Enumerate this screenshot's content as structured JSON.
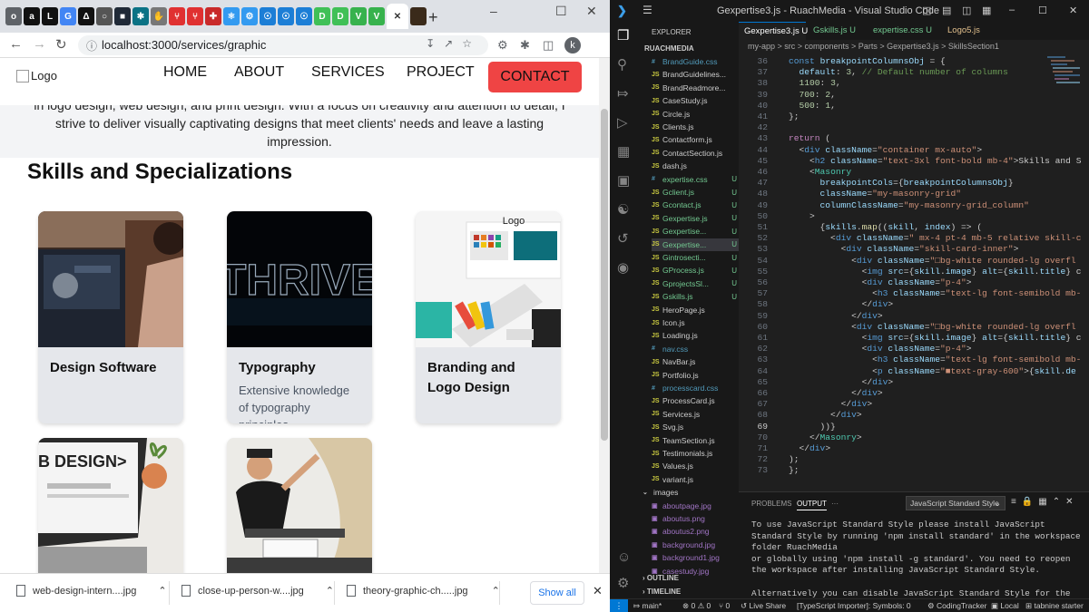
{
  "chrome": {
    "url": "localhost:3000/services/graphic",
    "window_controls": [
      "–",
      "☐",
      "✕"
    ],
    "tabs": [
      {
        "icon": "o",
        "color": "#5f6368"
      },
      {
        "icon": "a",
        "color": "#111"
      },
      {
        "icon": "L",
        "color": "#111"
      },
      {
        "icon": "G",
        "color": "#4285f4"
      },
      {
        "icon": "Δ",
        "color": "#111"
      },
      {
        "icon": "○",
        "color": "#555"
      },
      {
        "icon": "■",
        "color": "#1f2937"
      },
      {
        "icon": "✱",
        "color": "#0b7285"
      },
      {
        "icon": "✋",
        "color": "#777"
      },
      {
        "icon": "⑂",
        "color": "#e03131"
      },
      {
        "icon": "⑂",
        "color": "#e03131"
      },
      {
        "icon": "✚",
        "color": "#c92a2a"
      },
      {
        "icon": "⚛",
        "color": "#339af0"
      },
      {
        "icon": "⚙",
        "color": "#339af0"
      },
      {
        "icon": "☉",
        "color": "#1c7ed6"
      },
      {
        "icon": "☉",
        "color": "#1c7ed6"
      },
      {
        "icon": "☉",
        "color": "#1c7ed6"
      },
      {
        "icon": "D",
        "color": "#40c057"
      },
      {
        "icon": "D",
        "color": "#40c057"
      },
      {
        "icon": "V",
        "color": "#37b24d"
      },
      {
        "icon": "V",
        "color": "#37b24d"
      }
    ],
    "active_tab_close": "✕",
    "new_tab": "+",
    "avatar": "k"
  },
  "site": {
    "logo_alt": "Logo",
    "nav": [
      "HOME",
      "ABOUT",
      "SERVICES",
      "PROJECT"
    ],
    "contact": "CONTACT",
    "intro": "in logo design, web design, and print design. With a focus on creativity and attention to detail, I strive to deliver visually captivating designs that meet clients' needs and leave a lasting impression.",
    "section_title": "Skills and Specializations",
    "cards": [
      {
        "title": "Design Software",
        "desc": ""
      },
      {
        "title": "Typography",
        "desc": "Extensive knowledge of typography principles",
        "image_text": "THRIVE"
      },
      {
        "title": "Branding and Logo Design",
        "desc": "",
        "image_text": "Logo"
      },
      {
        "title": "",
        "desc": "",
        "image_text": "B DESIGN>"
      },
      {
        "title": "",
        "desc": ""
      }
    ]
  },
  "downloads": {
    "items": [
      "web-design-intern....jpg",
      "close-up-person-w....jpg",
      "theory-graphic-ch.....jpg"
    ],
    "chevron": "⌃",
    "show_all": "Show all",
    "close": "✕"
  },
  "vscode": {
    "title": "Gexpertise3.js - RuachMedia - Visual Studio Code",
    "explorer": "EXPLORER",
    "root": "RUACHMEDIA",
    "files": [
      {
        "name": "BrandGuide.css",
        "ic": "#",
        "color": "#519aba",
        "badge": ""
      },
      {
        "name": "BrandGuidelines...",
        "ic": "JS",
        "color": "#cbcb41",
        "badge": ""
      },
      {
        "name": "BrandReadmore...",
        "ic": "JS",
        "color": "#cbcb41",
        "badge": ""
      },
      {
        "name": "CaseStudy.js",
        "ic": "JS",
        "color": "#cbcb41",
        "badge": ""
      },
      {
        "name": "Circle.js",
        "ic": "JS",
        "color": "#cbcb41",
        "badge": ""
      },
      {
        "name": "Clients.js",
        "ic": "JS",
        "color": "#cbcb41",
        "badge": ""
      },
      {
        "name": "Contactform.js",
        "ic": "JS",
        "color": "#cbcb41",
        "badge": ""
      },
      {
        "name": "ContactSection.js",
        "ic": "JS",
        "color": "#cbcb41",
        "badge": ""
      },
      {
        "name": "dash.js",
        "ic": "JS",
        "color": "#cbcb41",
        "badge": ""
      },
      {
        "name": "expertise.css",
        "ic": "#",
        "color": "#73c991",
        "badge": "U"
      },
      {
        "name": "Gclient.js",
        "ic": "JS",
        "color": "#73c991",
        "badge": "U"
      },
      {
        "name": "Gcontact.js",
        "ic": "JS",
        "color": "#73c991",
        "badge": "U"
      },
      {
        "name": "Gexpertise.js",
        "ic": "JS",
        "color": "#73c991",
        "badge": "U"
      },
      {
        "name": "Gexpertise...",
        "ic": "JS",
        "color": "#73c991",
        "badge": "U"
      },
      {
        "name": "Gexpertise...",
        "ic": "JS",
        "color": "#73c991",
        "badge": "U"
      },
      {
        "name": "Gintrosecti...",
        "ic": "JS",
        "color": "#73c991",
        "badge": "U"
      },
      {
        "name": "GProcess.js",
        "ic": "JS",
        "color": "#73c991",
        "badge": "U"
      },
      {
        "name": "GprojectsSl...",
        "ic": "JS",
        "color": "#73c991",
        "badge": "U"
      },
      {
        "name": "Gskills.js",
        "ic": "JS",
        "color": "#73c991",
        "badge": "U"
      },
      {
        "name": "HeroPage.js",
        "ic": "JS",
        "color": "#cbcb41",
        "badge": ""
      },
      {
        "name": "Icon.js",
        "ic": "JS",
        "color": "#cbcb41",
        "badge": ""
      },
      {
        "name": "Loading.js",
        "ic": "JS",
        "color": "#cbcb41",
        "badge": ""
      },
      {
        "name": "nav.css",
        "ic": "#",
        "color": "#519aba",
        "badge": ""
      },
      {
        "name": "NavBar.js",
        "ic": "JS",
        "color": "#cbcb41",
        "badge": ""
      },
      {
        "name": "Portfolio.js",
        "ic": "JS",
        "color": "#cbcb41",
        "badge": ""
      },
      {
        "name": "processcard.css",
        "ic": "#",
        "color": "#519aba",
        "badge": ""
      },
      {
        "name": "ProcessCard.js",
        "ic": "JS",
        "color": "#cbcb41",
        "badge": ""
      },
      {
        "name": "Services.js",
        "ic": "JS",
        "color": "#cbcb41",
        "badge": ""
      },
      {
        "name": "Svg.js",
        "ic": "JS",
        "color": "#cbcb41",
        "badge": ""
      },
      {
        "name": "TeamSection.js",
        "ic": "JS",
        "color": "#cbcb41",
        "badge": ""
      },
      {
        "name": "Testimonials.js",
        "ic": "JS",
        "color": "#cbcb41",
        "badge": ""
      },
      {
        "name": "Values.js",
        "ic": "JS",
        "color": "#cbcb41",
        "badge": ""
      },
      {
        "name": "variant.js",
        "ic": "JS",
        "color": "#cbcb41",
        "badge": ""
      },
      {
        "name": "images",
        "ic": "⌄",
        "color": "#ccc",
        "badge": ""
      },
      {
        "name": "aboutpage.jpg",
        "ic": "▣",
        "color": "#a074c4",
        "badge": ""
      },
      {
        "name": "aboutus.png",
        "ic": "▣",
        "color": "#a074c4",
        "badge": ""
      },
      {
        "name": "aboutus2.png",
        "ic": "▣",
        "color": "#a074c4",
        "badge": ""
      },
      {
        "name": "background.jpg",
        "ic": "▣",
        "color": "#a074c4",
        "badge": ""
      },
      {
        "name": "background1.jpg",
        "ic": "▣",
        "color": "#a074c4",
        "badge": ""
      },
      {
        "name": "casestudy.jpg",
        "ic": "▣",
        "color": "#a074c4",
        "badge": ""
      }
    ],
    "outline": "OUTLINE",
    "timeline": "TIMELINE",
    "editor_tabs": [
      {
        "label": "Gexpertise3.js U",
        "active": true
      },
      {
        "label": "Gskills.js U",
        "active": false
      },
      {
        "label": "expertise.css U",
        "active": false
      },
      {
        "label": "Logo5.js",
        "active": false
      }
    ],
    "breadcrumb": "my-app  >  src  >  components  >  Parts  >  Gexpertise3.js  >  SkillsSection1",
    "code_lines": [
      {
        "n": "36",
        "html": "<span class='k'>const</span> <span class='v'>breakpointColumnsObj</span> = {"
      },
      {
        "n": "37",
        "html": "  <span class='v'>default</span>: <span class='n'>3</span>, <span class='c'>// Default number of columns</span>"
      },
      {
        "n": "38",
        "html": "  <span class='n'>1100</span>: <span class='n'>3</span>,"
      },
      {
        "n": "39",
        "html": "  <span class='n'>700</span>: <span class='n'>2</span>,"
      },
      {
        "n": "40",
        "html": "  <span class='n'>500</span>: <span class='n'>1</span>,"
      },
      {
        "n": "41",
        "html": "};"
      },
      {
        "n": "42",
        "html": ""
      },
      {
        "n": "43",
        "html": "<span class='kw'>return</span> ("
      },
      {
        "n": "44",
        "html": "  &lt;<span class='tg'>div</span> <span class='at'>className</span>=<span class='s'>\"container mx-auto\"</span>&gt;"
      },
      {
        "n": "45",
        "html": "    &lt;<span class='tg'>h2</span> <span class='at'>className</span>=<span class='s'>\"text-3xl font-bold mb-4\"</span>&gt;Skills and S"
      },
      {
        "n": "46",
        "html": "    &lt;<span class='t'>Masonry</span>"
      },
      {
        "n": "47",
        "html": "      <span class='at'>breakpointCols</span>={<span class='v'>breakpointColumnsObj</span>}"
      },
      {
        "n": "48",
        "html": "      <span class='at'>className</span>=<span class='s'>\"my-masonry-grid\"</span>"
      },
      {
        "n": "49",
        "html": "      <span class='at'>columnClassName</span>=<span class='s'>\"my-masonry-grid_column\"</span>"
      },
      {
        "n": "50",
        "html": "    &gt;"
      },
      {
        "n": "51",
        "html": "      {<span class='v'>skills</span>.<span class='f'>map</span>((<span class='v'>skill</span>, <span class='v'>index</span>) =&gt; ("
      },
      {
        "n": "52",
        "html": "        &lt;<span class='tg'>div</span> <span class='at'>className</span>=<span class='s'>\" mx-4 pt-4 mb-5 relative skill-c</span>"
      },
      {
        "n": "53",
        "html": "          &lt;<span class='tg'>div</span> <span class='at'>className</span>=<span class='s'>\"skill-card-inner\"</span>&gt;"
      },
      {
        "n": "54",
        "html": "            &lt;<span class='tg'>div</span> <span class='at'>className</span>=<span class='s'>\"□bg-white rounded-lg overfl</span>"
      },
      {
        "n": "55",
        "html": "              &lt;<span class='tg'>img</span> <span class='at'>src</span>={<span class='v'>skill</span>.<span class='v'>image</span>} <span class='at'>alt</span>={<span class='v'>skill</span>.<span class='v'>title</span>} c"
      },
      {
        "n": "56",
        "html": "              &lt;<span class='tg'>div</span> <span class='at'>className</span>=<span class='s'>\"p-4\"</span>&gt;"
      },
      {
        "n": "57",
        "html": "                &lt;<span class='tg'>h3</span> <span class='at'>className</span>=<span class='s'>\"text-lg font-semibold mb-</span>"
      },
      {
        "n": "58",
        "html": "              &lt;/<span class='tg'>div</span>&gt;"
      },
      {
        "n": "59",
        "html": "            &lt;/<span class='tg'>div</span>&gt;"
      },
      {
        "n": "60",
        "html": "            &lt;<span class='tg'>div</span> <span class='at'>className</span>=<span class='s'>\"□bg-white rounded-lg overfl</span>"
      },
      {
        "n": "61",
        "html": "              &lt;<span class='tg'>img</span> <span class='at'>src</span>={<span class='v'>skill</span>.<span class='v'>image</span>} <span class='at'>alt</span>={<span class='v'>skill</span>.<span class='v'>title</span>} c"
      },
      {
        "n": "62",
        "html": "              &lt;<span class='tg'>div</span> <span class='at'>className</span>=<span class='s'>\"p-4\"</span>&gt;"
      },
      {
        "n": "63",
        "html": "                &lt;<span class='tg'>h3</span> <span class='at'>className</span>=<span class='s'>\"text-lg font-semibold mb-</span>"
      },
      {
        "n": "64",
        "html": "                &lt;<span class='tg'>p</span> <span class='at'>className</span>=<span class='s'>\"■text-gray-600\"</span>&gt;{<span class='v'>skill</span>.<span class='v'>de</span>"
      },
      {
        "n": "65",
        "html": "              &lt;/<span class='tg'>div</span>&gt;"
      },
      {
        "n": "66",
        "html": "            &lt;/<span class='tg'>div</span>&gt;"
      },
      {
        "n": "67",
        "html": "          &lt;/<span class='tg'>div</span>&gt;"
      },
      {
        "n": "68",
        "html": "        &lt;/<span class='tg'>div</span>&gt;"
      },
      {
        "n": "69",
        "html": "      ))}"
      },
      {
        "n": "70",
        "html": "    &lt;/<span class='t'>Masonry</span>&gt;"
      },
      {
        "n": "71",
        "html": "  &lt;/<span class='tg'>div</span>&gt;"
      },
      {
        "n": "72",
        "html": ");"
      },
      {
        "n": "73",
        "html": "};"
      }
    ],
    "current_line": "69",
    "panel_tabs": [
      "PROBLEMS",
      "OUTPUT"
    ],
    "panel_more": "···",
    "output_channel": "JavaScript Standard Style",
    "output": "To use JavaScript Standard Style please install JavaScript Standard Style by running 'npm install standard' in the workspace folder RuachMedia\nor globally using 'npm install -g standard'. You need to reopen the workspace after installing JavaScript Standard Style.\n\nAlternatively you can disable JavaScript Standard Style for the",
    "status": {
      "branch": "main*",
      "errors": "⊗ 0 ⚠ 0",
      "ports": "⑂ 0",
      "live": "Live Share",
      "ts": "[TypeScript Importer]: Symbols: 0",
      "coding": "CodingTracker",
      "local": "Local",
      "tabnine": "tabnine starter"
    }
  }
}
